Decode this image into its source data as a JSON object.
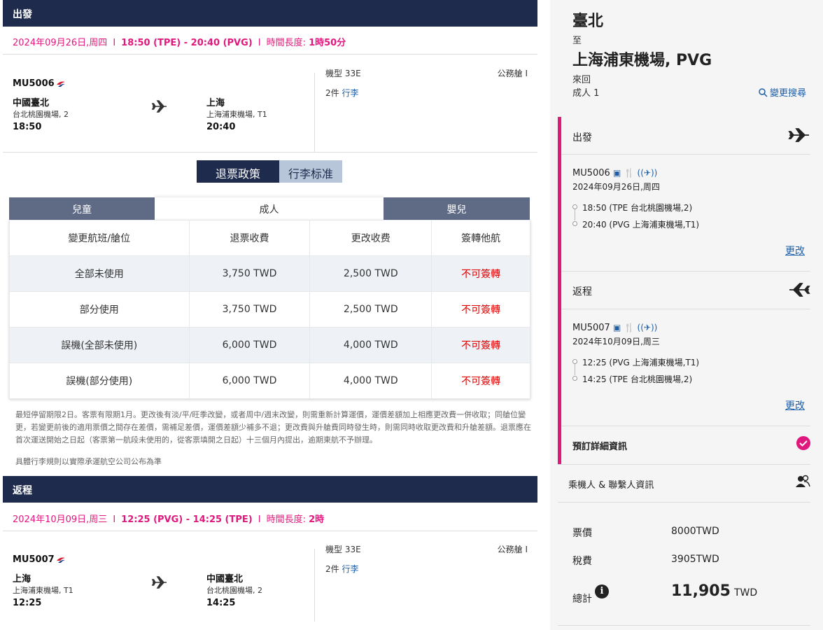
{
  "outbound": {
    "section_title": "出發",
    "date": "2024年09月26日,周四",
    "time_range": "18:50 (TPE) - 20:40 (PVG)",
    "duration_label": "時間長度:",
    "duration": "1時50分",
    "flight_no": "MU5006",
    "from_city": "中國臺北",
    "from_airport": "台北桃園機場, 2",
    "from_time": "18:50",
    "to_city": "上海",
    "to_airport": "上海浦東機場, T1",
    "to_time": "20:40",
    "aircraft": "機型 33E",
    "cabin": "公務艙 I",
    "bag_count": "2件",
    "bag_link": "行李"
  },
  "policy": {
    "tab_refund": "退票政策",
    "tab_baggage": "行李标准",
    "pax_tabs": [
      "兒童",
      "成人",
      "嬰兒"
    ],
    "headers": [
      "變更航班/艙位",
      "退票收費",
      "更改收费",
      "簽轉他航"
    ],
    "rows": [
      [
        "全部未使用",
        "3,750 TWD",
        "2,500 TWD",
        "不可簽轉"
      ],
      [
        "部分使用",
        "3,750 TWD",
        "2,500 TWD",
        "不可簽轉"
      ],
      [
        "誤機(全部未使用)",
        "6,000 TWD",
        "4,000 TWD",
        "不可簽轉"
      ],
      [
        "誤機(部分使用)",
        "6,000 TWD",
        "4,000 TWD",
        "不可簽轉"
      ]
    ],
    "note": "最短停留期限2日。客票有限期1月。更改後有淡/平/旺季改變，或者周中/週末改變，則需重新計算運價，運價差額加上相應更改費一併收取；同艙位變更，若變更前後的適用票價之間存在差價，需補足差價，運價差額少補多不退；更改費與升艙費同時發生時，則需同時收取更改費和升艙差額。退票應在首次運送開始之日起（客票第一航段未使用的，從客票填開之日起）十三個月內提出，逾期東航不予辦理。",
    "baggage_note": "具體行李規則以實際承運航空公司公布為準"
  },
  "inbound": {
    "section_title": "返程",
    "date": "2024年10月09日,周三",
    "time_range": "12:25 (PVG) - 14:25 (TPE)",
    "duration_label": "時間長度:",
    "duration": "2時",
    "flight_no": "MU5007",
    "from_city": "上海",
    "from_airport": "上海浦東機場, T1",
    "from_time": "12:25",
    "to_city": "中國臺北",
    "to_airport": "台北桃園機場, 2",
    "to_time": "14:25",
    "aircraft": "機型 33E",
    "cabin": "公務艙 I",
    "bag_count": "2件",
    "bag_link": "行李"
  },
  "summary": {
    "origin": "臺北",
    "to_word": "至",
    "destination": "上海浦東機場, PVG",
    "trip_type": "來回",
    "pax": "成人 1",
    "change_search": "變更搜尋",
    "outbound": {
      "title": "出發",
      "flight_no": "MU5006",
      "date": "2024年09月26日,周四",
      "dep": "18:50 (TPE 台北桃園機場,2)",
      "arr": "20:40 (PVG 上海浦東機場,T1)",
      "change": "更改"
    },
    "inbound": {
      "title": "返程",
      "flight_no": "MU5007",
      "date": "2024年10月09日,周三",
      "dep": "12:25 (PVG 上海浦東機場,T1)",
      "arr": "14:25 (TPE 台北桃園機場,2)",
      "change": "更改"
    },
    "booking_details": "預訂詳細資訊",
    "passenger_info": "乘機人 & 聯繫人資訊",
    "fare_label": "票價",
    "fare": "8000TWD",
    "tax_label": "稅費",
    "tax": "3905TWD",
    "total_label": "總計",
    "total": "11,905",
    "currency": "TWD"
  },
  "colors": {
    "navy": "#1f2b4d",
    "pink": "#e0187d",
    "link_blue": "#1c5fa8",
    "red": "#e00000"
  }
}
